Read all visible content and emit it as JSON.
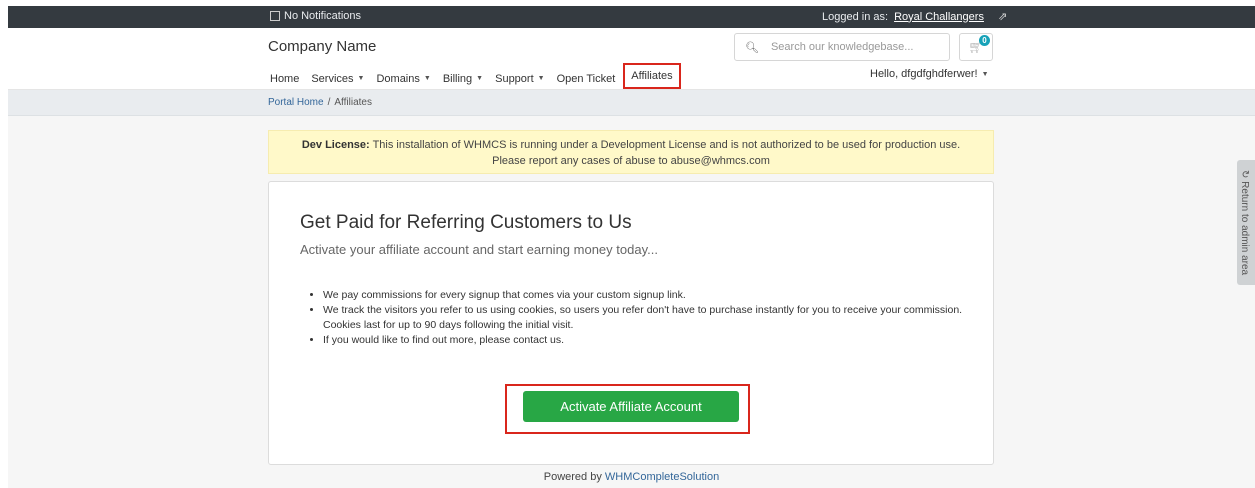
{
  "topbar": {
    "notifications": "No Notifications",
    "logged_in_label": "Logged in as:",
    "logged_in_user": "Royal Challangers"
  },
  "header": {
    "brand": "Company Name",
    "search_placeholder": "Search our knowledgebase...",
    "cart_count": "0"
  },
  "nav": {
    "items": [
      {
        "label": "Home"
      },
      {
        "label": "Services"
      },
      {
        "label": "Domains"
      },
      {
        "label": "Billing"
      },
      {
        "label": "Support"
      },
      {
        "label": "Open Ticket"
      },
      {
        "label": "Affiliates"
      }
    ],
    "hello": "Hello, dfgdfghdferwer!"
  },
  "breadcrumb": {
    "home": "Portal Home",
    "separator": "/",
    "current": "Affiliates"
  },
  "dev_license": {
    "label": "Dev License:",
    "line1": "This installation of WHMCS is running under a Development License and is not authorized to be used for production use.",
    "line2": "Please report any cases of abuse to abuse@whmcs.com"
  },
  "card": {
    "title": "Get Paid for Referring Customers to Us",
    "subtitle": "Activate your affiliate account and start earning money today...",
    "bullets": [
      "We pay commissions for every signup that comes via your custom signup link.",
      "We track the visitors you refer to us using cookies, so users you refer don't have to purchase instantly for you to receive your commission. Cookies last for up to 90 days following the initial visit.",
      "If you would like to find out more, please contact us."
    ],
    "activate_button": "Activate Affiliate Account"
  },
  "footer": {
    "powered_by": "Powered by",
    "link": "WHMCompleteSolution"
  },
  "return_tab": {
    "label": "Return to admin area"
  },
  "colors": {
    "topbar": "#343a40",
    "accent_green": "#28a745",
    "highlight_red": "#d9261c",
    "link_blue": "#336699"
  }
}
